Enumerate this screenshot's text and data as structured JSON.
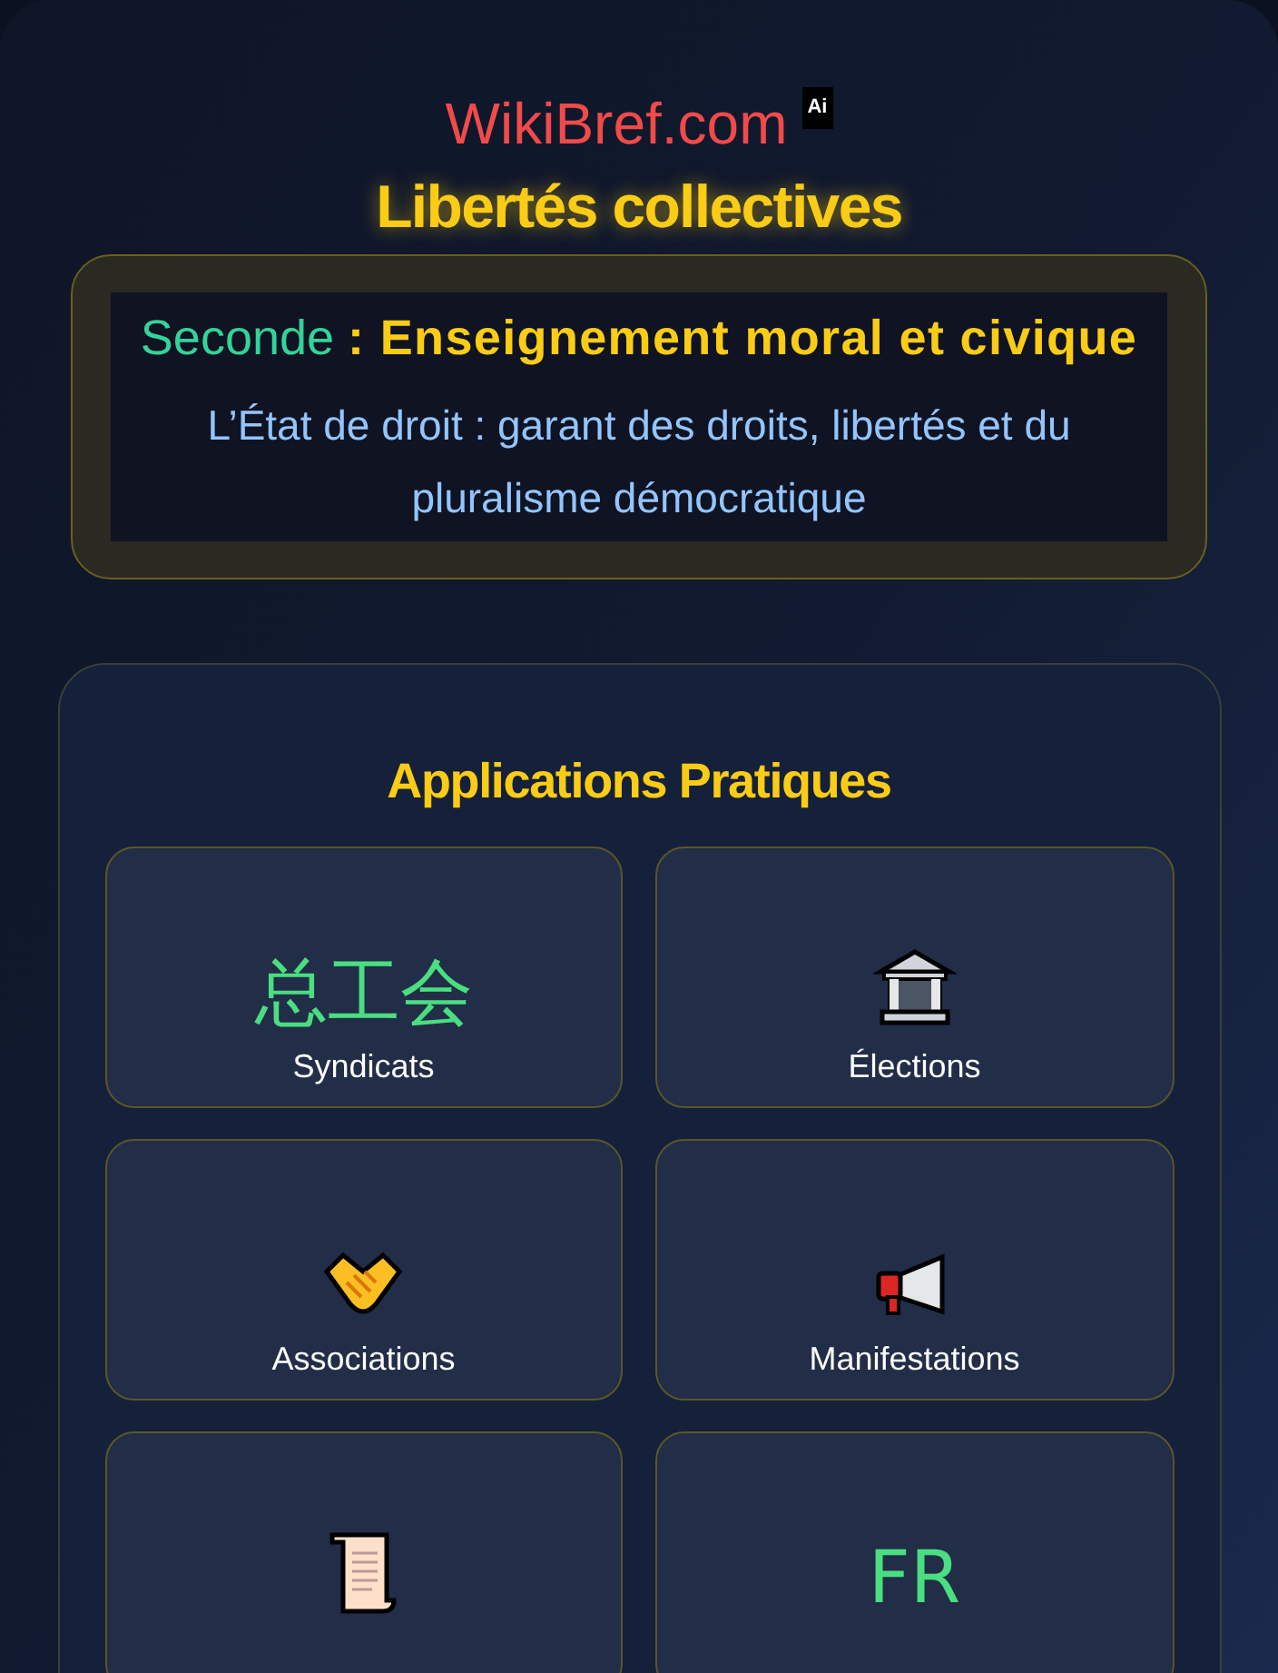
{
  "brand": {
    "name": "WikiBref.com",
    "badge": "Ai"
  },
  "title": "Libertés collectives",
  "subject": {
    "level": "Seconde",
    "course": ": Enseignement moral et civique",
    "description": "L’État de droit : garant des droits, libertés et du pluralisme démocratique"
  },
  "section": {
    "heading": "Applications Pratiques",
    "cards": [
      {
        "kind": "glyph",
        "glyph": "总工会",
        "label": "Syndicats"
      },
      {
        "kind": "bank",
        "label": "Élections"
      },
      {
        "kind": "handshake",
        "label": "Associations"
      },
      {
        "kind": "megaphone",
        "label": "Manifestations"
      },
      {
        "kind": "scroll"
      },
      {
        "kind": "glyph",
        "glyph": "FR"
      }
    ]
  }
}
